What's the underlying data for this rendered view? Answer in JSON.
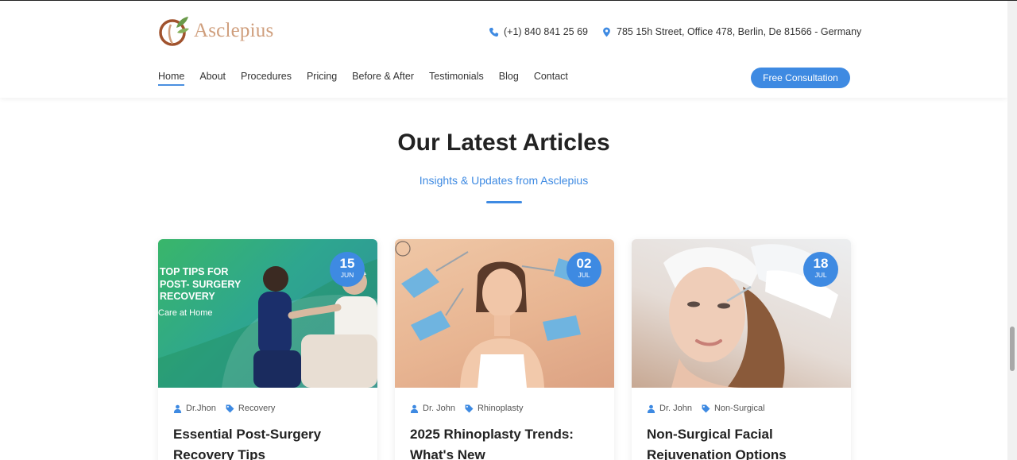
{
  "brand": {
    "name": "Asclepius"
  },
  "contact": {
    "phone": "(+1) 840 841 25 69",
    "address": "785 15h Street, Office 478, Berlin, De 81566 - Germany"
  },
  "nav": {
    "items": [
      {
        "label": "Home",
        "active": true
      },
      {
        "label": "About"
      },
      {
        "label": "Procedures"
      },
      {
        "label": "Pricing"
      },
      {
        "label": "Before & After"
      },
      {
        "label": "Testimonials"
      },
      {
        "label": "Blog"
      },
      {
        "label": "Contact"
      }
    ],
    "cta_label": "Free Consultation"
  },
  "section": {
    "title": "Our Latest Articles",
    "subtitle": "Insights & Updates from Asclepius"
  },
  "articles": [
    {
      "day": "15",
      "month": "JUN",
      "author": "Dr.Jhon",
      "category": "Recovery",
      "title": "Essential Post-Surgery Recovery Tips",
      "image_text": "TOP TIPS FOR POST- SURGERY RECOVERY",
      "image_subtext": "Care at Home"
    },
    {
      "day": "02",
      "month": "JUL",
      "author": "Dr. John",
      "category": "Rhinoplasty",
      "title": "2025 Rhinoplasty Trends: What's New"
    },
    {
      "day": "18",
      "month": "JUL",
      "author": "Dr. John",
      "category": "Non-Surgical",
      "title": "Non-Surgical Facial Rejuvenation Options"
    }
  ],
  "colors": {
    "accent": "#3e8ae2",
    "brand": "#cf9e7c",
    "leaf": "#6a9a4a",
    "logo_dark": "#a0522d"
  },
  "icons": {
    "phone": "phone-icon",
    "location": "location-pin-icon",
    "user": "user-icon",
    "tag": "tag-icon"
  }
}
